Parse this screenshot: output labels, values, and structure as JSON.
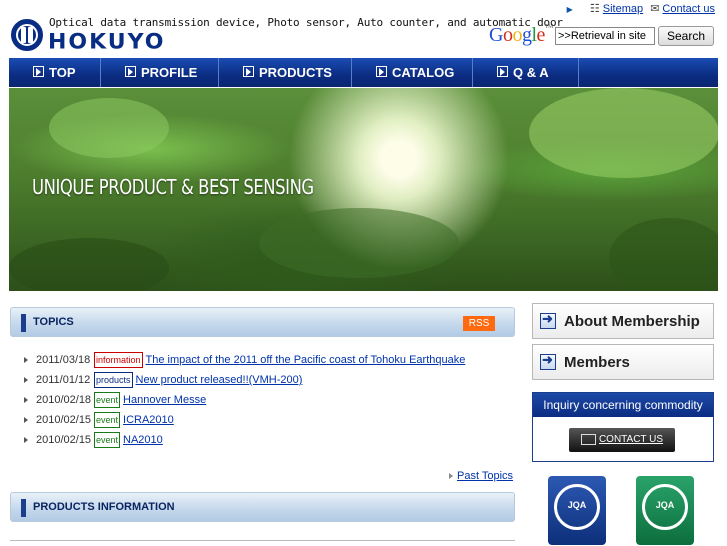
{
  "header": {
    "tagline": "Optical data transmission device, Photo sensor, Auto counter, and automatic door",
    "brand": "HOKUYO",
    "top_links": {
      "sitemap": "Sitemap",
      "contact": "Contact us"
    },
    "search": {
      "engine": "Google",
      "value": ">>Retrieval in site",
      "button": "Search"
    }
  },
  "nav": {
    "items": [
      {
        "label": "TOP"
      },
      {
        "label": "PROFILE"
      },
      {
        "label": "PRODUCTS"
      },
      {
        "label": "CATALOG"
      },
      {
        "label": "Q & A"
      }
    ]
  },
  "hero": {
    "text": "UNIQUE PRODUCT & BEST SENSING"
  },
  "topics": {
    "title": "TOPICS",
    "rss": "RSS",
    "items": [
      {
        "date": "2011/03/18",
        "tag": "information",
        "title": "The impact of the 2011 off the Pacific coast of Tohoku Earthquake"
      },
      {
        "date": "2011/01/12",
        "tag": "products",
        "title": "New product released!!(VMH-200)"
      },
      {
        "date": "2010/02/18",
        "tag": "event",
        "title": "Hannover Messe"
      },
      {
        "date": "2010/02/15",
        "tag": "event",
        "title": "ICRA2010"
      },
      {
        "date": "2010/02/15",
        "tag": "event",
        "title": "NA2010"
      }
    ],
    "past_link": "Past Topics"
  },
  "products_info": {
    "title": "PRODUCTS INFORMATION"
  },
  "sidebar": {
    "membership": "About Membership",
    "members": "Members",
    "inquiry_title": "Inquiry concerning commodity",
    "contact_button": "CONTACT US"
  },
  "colors": {
    "nav_blue": "#0b2c82",
    "accent_orange": "#ff6a10",
    "brand_blue": "#0a2d84"
  }
}
